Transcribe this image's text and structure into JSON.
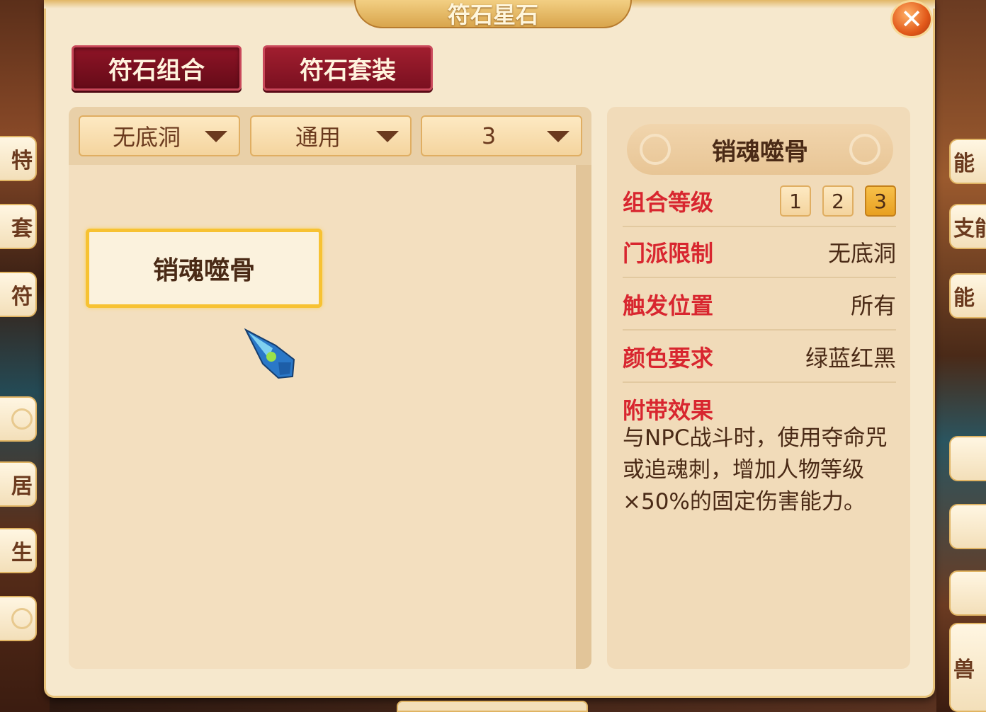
{
  "window": {
    "title": "符石星石",
    "close_symbol": "✕"
  },
  "tabs": [
    {
      "label": "符石组合",
      "active": true
    },
    {
      "label": "符石套装",
      "active": false
    }
  ],
  "filters": {
    "sect": "无底洞",
    "type": "通用",
    "level": "3"
  },
  "combo_list": [
    {
      "name": "销魂噬骨",
      "selected": true
    }
  ],
  "detail": {
    "name": "销魂噬骨",
    "combo_level_label": "组合等级",
    "levels": [
      "1",
      "2",
      "3"
    ],
    "active_level": "3",
    "sect_limit_label": "门派限制",
    "sect_limit_value": "无底洞",
    "trigger_label": "触发位置",
    "trigger_value": "所有",
    "color_label": "颜色要求",
    "color_value": "绿蓝红黑",
    "effect_label": "附带效果",
    "effect_text": "与NPC战斗时，使用夺命咒或追魂刺，增加人物等级×50%的固定伤害能力。"
  },
  "side_tabs_left": [
    "特",
    "套",
    "符",
    "",
    "居",
    "生",
    ""
  ],
  "side_tabs_right": [
    "能",
    "支能",
    "能",
    "",
    "",
    "",
    "兽"
  ],
  "colors": {
    "accent_red": "#d8262f",
    "tab_red": "#8e1426",
    "selected_border": "#f7c232",
    "panel_bg": "#f1dbb9"
  }
}
